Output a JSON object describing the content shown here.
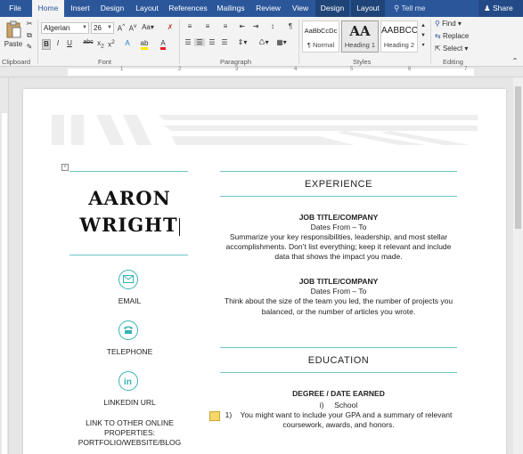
{
  "tabs": [
    {
      "label": "File",
      "active": false,
      "context": false
    },
    {
      "label": "Home",
      "active": true,
      "context": false
    },
    {
      "label": "Insert",
      "active": false,
      "context": false
    },
    {
      "label": "Design",
      "active": false,
      "context": false
    },
    {
      "label": "Layout",
      "active": false,
      "context": false
    },
    {
      "label": "References",
      "active": false,
      "context": false
    },
    {
      "label": "Mailings",
      "active": false,
      "context": false
    },
    {
      "label": "Review",
      "active": false,
      "context": false
    },
    {
      "label": "View",
      "active": false,
      "context": false
    },
    {
      "label": "Design",
      "active": false,
      "context": true
    },
    {
      "label": "Layout",
      "active": false,
      "context": true
    }
  ],
  "tell_me": "Tell me",
  "share": "Share",
  "ribbon": {
    "paste": "Paste",
    "clipboard_label": "Clipboard",
    "font_name": "Algerian",
    "font_size": "26",
    "font_label": "Font",
    "paragraph_label": "Paragraph",
    "styles": [
      {
        "sample": "AaBbCcDc",
        "name": "¶ Normal",
        "selected": false
      },
      {
        "sample": "AA",
        "name": "Heading 1",
        "selected": true
      },
      {
        "sample": "AABBCC",
        "name": "Heading 2",
        "selected": false
      }
    ],
    "styles_label": "Styles",
    "find": "Find",
    "replace": "Replace",
    "select": "Select",
    "editing_label": "Editing"
  },
  "ruler_numbers": [
    "1",
    "2",
    "3",
    "4",
    "5",
    "6",
    "7"
  ],
  "resume": {
    "first_name": "AARON",
    "last_name": "WRIGHT",
    "email": "EMAIL",
    "telephone": "TELEPHONE",
    "linkedin": "LINKEDIN URL",
    "other_1": "LINK TO OTHER ONLINE",
    "other_2": "PROPERTIES:",
    "other_3": "PORTFOLIO/WEBSITE/BLOG",
    "experience_head": "EXPERIENCE",
    "job1_title": "JOB TITLE/COMPANY",
    "job1_dates": "Dates From – To",
    "job1_desc_1": "Summarize your key responsibilities, leadership, and most stellar",
    "job1_desc_2": "accomplishments. Don’t list everything; keep it relevant and include",
    "job1_desc_3": "data that shows the impact you made.",
    "job2_title": "JOB TITLE/COMPANY",
    "job2_dates": "Dates From – To",
    "job2_desc_1": "Think about the size of the team you led, the number of projects you",
    "job2_desc_2": "balanced, or the number of articles you wrote.",
    "education_head": "EDUCATION",
    "degree": "DEGREE / DATE EARNED",
    "school_num": "i)",
    "school": "School",
    "edu_num": "1)",
    "edu_desc_1": "You might want to include your GPA and a summary of relevant",
    "edu_desc_2": "coursework, awards, and honors."
  },
  "colors": {
    "accent": "#2b579a",
    "teal": "#37b2b0"
  },
  "icons": [
    "envelope-icon",
    "telephone-icon",
    "linkedin-icon",
    "table-move-icon"
  ]
}
